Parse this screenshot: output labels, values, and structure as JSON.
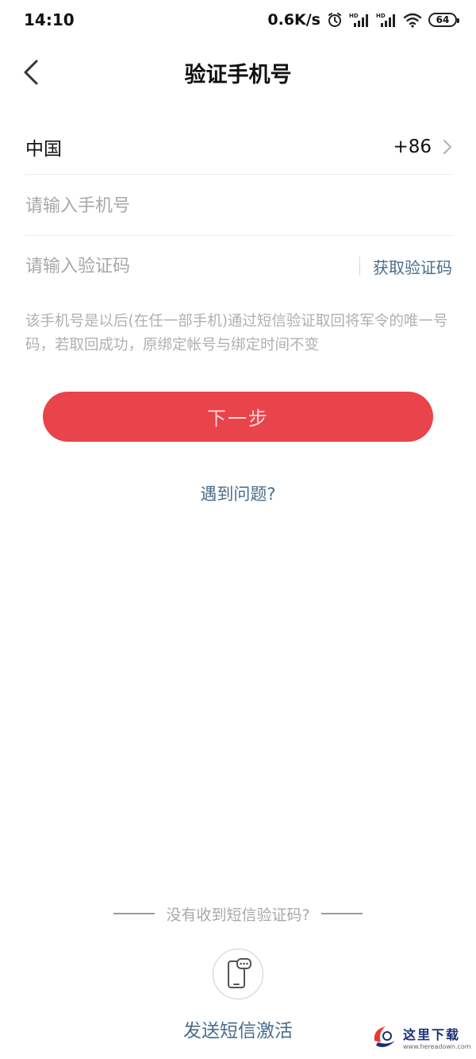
{
  "status_bar": {
    "time": "14:10",
    "net_speed": "0.6K/s",
    "battery": "64",
    "icons": [
      "alarm-icon",
      "hd-signal-icon",
      "hd-signal-icon",
      "wifi-icon",
      "battery-icon"
    ]
  },
  "nav": {
    "back_icon": "chevron-left-icon",
    "title": "验证手机号"
  },
  "form": {
    "country_label": "中国",
    "country_code": "+86",
    "phone_placeholder": "请输入手机号",
    "code_placeholder": "请输入验证码",
    "get_code_label": "获取验证码"
  },
  "hint": "该手机号是以后(在任一部手机)通过短信验证取回将军令的唯一号码，若取回成功，原绑定帐号与绑定时间不变",
  "next_button": "下一步",
  "help_link": "遇到问题?",
  "sms": {
    "question": "没有收到短信验证码?",
    "icon": "phone-sms-icon",
    "send_label": "发送短信激活"
  },
  "watermark": {
    "name": "这里下载",
    "url": "www.hereadown.com"
  },
  "colors": {
    "accent_red": "#e9434b",
    "link_blue": "#4a6d8c",
    "placeholder_gray": "#a8a8a8"
  }
}
